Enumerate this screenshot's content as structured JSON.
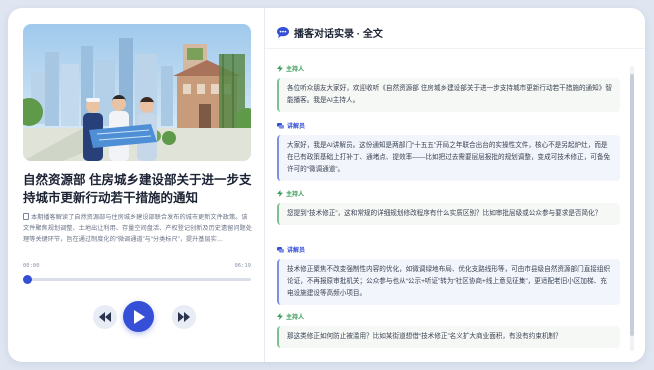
{
  "article": {
    "title": "自然资源部 住房城乡建设部关于进一步支持城市更新行动若干措施的通知",
    "summary_icon": "document-icon",
    "summary": "本期播客解读了自然资源部与住房城乡建设部联合发布的城市更新文件政策。该文件聚焦规划调整、土地出让利用、存量空间盘活、产权登记创新及历史遗留问题处理等关键环节，旨在通过制度化的“微调通道”与“分类标尺”，提升基层实…"
  },
  "player": {
    "current_time": "00:00",
    "total_time": "06:19",
    "progress": 0.0,
    "rewind_icon": "rewind-icon",
    "play_icon": "play-icon",
    "forward_icon": "fast-forward-icon"
  },
  "transcript": {
    "header_icon": "chat-bubble-icon",
    "title": "播客对话实录 · 全文",
    "messages": [
      {
        "role": "host",
        "icon": "host-icon",
        "speaker": "主持人",
        "text": "各位听众朋友大家好，欢迎收听《自然资源部 住房城乡建设部关于进一步支持城市更新行动若干措施的通知》智能播客。我是AI主持人。"
      },
      {
        "role": "guest",
        "icon": "expert-icon",
        "speaker": "讲解员",
        "text": "大家好，我是AI讲解员。这份通知是两部门“十五五”开局之年联合出台的实操性文件，核心不是另起炉灶，而是在已有政策基础上打补丁、通堵点、提效率——比如把过去需要层层报批的规划调整，变成可技术修正，可备免许可的“微调通道”。"
      },
      {
        "role": "host",
        "icon": "host-icon",
        "speaker": "主持人",
        "text": "您提到“技术修正”，这和常规的详细规划修改程序有什么实质区别？比如审批层级或公众参与要求是否简化？"
      },
      {
        "role": "guest",
        "icon": "expert-icon",
        "speaker": "讲解员",
        "text": "技术修正聚焦不改变强制性内容的优化，如微调绿地布局、优化支路线形等，可由市县级自然资源部门直接组织论证，不再报原审批机关；公众参与也从“公示+听证”转为“社区协商+线上意见征集”，更适配老旧小区加梯、充电设施建设等高频小项目。"
      },
      {
        "role": "host",
        "icon": "host-icon",
        "speaker": "主持人",
        "text": "那这类修正如何防止被滥用？比如某街道想借“技术修正”名义扩大商业面积，有没有约束机制？"
      }
    ]
  },
  "colors": {
    "accent": "#3550d6",
    "host": "#3a9a5a",
    "card_bg": "#ffffff",
    "page_bg": "#dfe6f1"
  }
}
